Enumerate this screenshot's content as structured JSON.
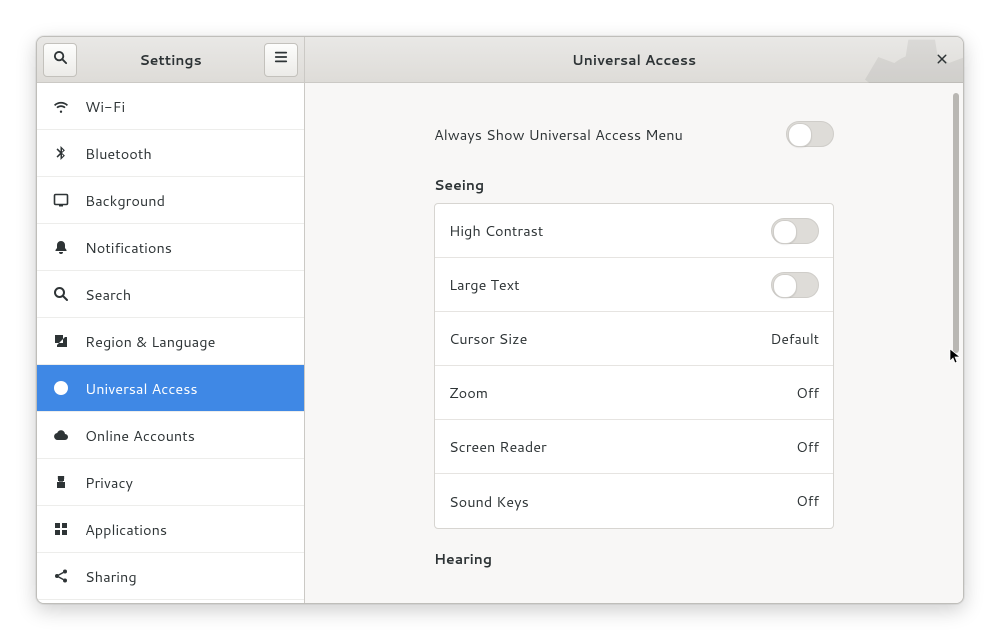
{
  "header": {
    "sidebar_title": "Settings",
    "content_title": "Universal Access"
  },
  "sidebar": {
    "items": [
      {
        "id": "wifi",
        "label": "Wi-Fi"
      },
      {
        "id": "bluetooth",
        "label": "Bluetooth"
      },
      {
        "id": "background",
        "label": "Background"
      },
      {
        "id": "notifications",
        "label": "Notifications"
      },
      {
        "id": "search",
        "label": "Search"
      },
      {
        "id": "region",
        "label": "Region & Language"
      },
      {
        "id": "universal",
        "label": "Universal Access"
      },
      {
        "id": "online",
        "label": "Online Accounts"
      },
      {
        "id": "privacy",
        "label": "Privacy"
      },
      {
        "id": "applications",
        "label": "Applications"
      },
      {
        "id": "sharing",
        "label": "Sharing"
      }
    ],
    "active_index": 6
  },
  "main": {
    "always_show_label": "Always Show Universal Access Menu",
    "always_show_state": "off",
    "sections": [
      {
        "title": "Seeing",
        "rows": [
          {
            "label": "High Contrast",
            "type": "switch",
            "state": "off"
          },
          {
            "label": "Large Text",
            "type": "switch",
            "state": "off"
          },
          {
            "label": "Cursor Size",
            "type": "value",
            "value": "Default"
          },
          {
            "label": "Zoom",
            "type": "value",
            "value": "Off"
          },
          {
            "label": "Screen Reader",
            "type": "value",
            "value": "Off"
          },
          {
            "label": "Sound Keys",
            "type": "value",
            "value": "Off"
          }
        ]
      },
      {
        "title": "Hearing",
        "rows": []
      }
    ]
  }
}
